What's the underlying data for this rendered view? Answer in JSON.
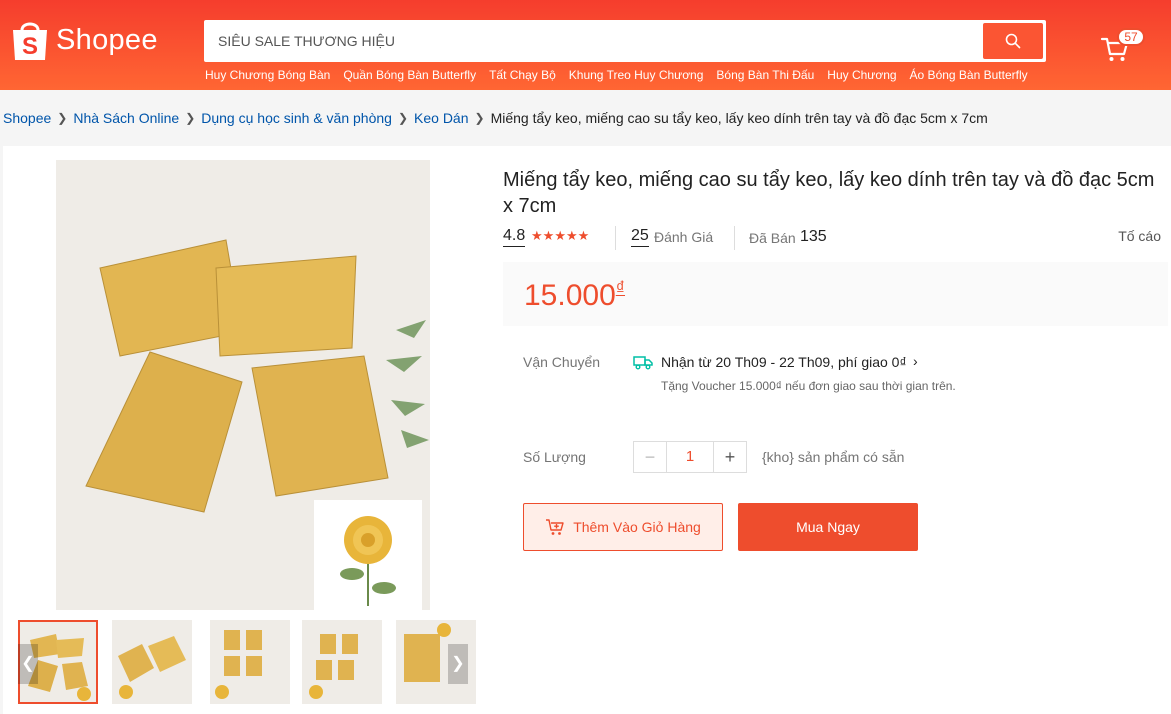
{
  "header": {
    "brand": "Shopee",
    "search_placeholder": "SIÊU SALE THƯƠNG HIỆU",
    "cart_count": "57",
    "suggestions": [
      "Huy Chương Bóng Bàn",
      "Quần Bóng Bàn Butterfly",
      "Tất Chạy Bộ",
      "Khung Treo Huy Chương",
      "Bóng Bàn Thi Đấu",
      "Huy Chương",
      "Áo Bóng Bàn Butterfly"
    ]
  },
  "breadcrumb": {
    "items": [
      "Shopee",
      "Nhà Sách Online",
      "Dụng cụ học sinh & văn phòng",
      "Keo Dán"
    ],
    "current": "Miếng tẩy keo, miếng cao su tẩy keo, lấy keo dính trên tay và đồ đạc 5cm x 7cm"
  },
  "product": {
    "title": "Miếng tẩy keo, miếng cao su tẩy keo, lấy keo dính trên tay và đồ đạc 5cm x 7cm",
    "rating": "4.8",
    "star_count": 5,
    "reviews_count": "25",
    "reviews_label": "Đánh Giá",
    "sold_label": "Đã Bán",
    "sold_count": "135",
    "report_label": "Tố cáo",
    "price": "15.000",
    "currency": "₫"
  },
  "shipping": {
    "label": "Vận Chuyển",
    "main": "Nhận từ 20 Th09 - 22 Th09, phí giao 0₫",
    "sub": "Tặng Voucher 15.000₫ nếu đơn giao sau thời gian trên."
  },
  "quantity": {
    "label": "Số Lượng",
    "value": "1",
    "stock_text": "{kho} sản phẩm có sẵn"
  },
  "actions": {
    "add_to_cart": "Thêm Vào Giỏ Hàng",
    "buy_now": "Mua Ngay"
  },
  "colors": {
    "brand": "#ee4d2d",
    "eraser": "#e1b550"
  },
  "icons": [
    "search-icon",
    "cart-icon",
    "truck-icon",
    "chevron-right-icon",
    "chevron-left-icon",
    "minus-icon",
    "plus-icon",
    "cart-add-icon",
    "star-icon"
  ]
}
